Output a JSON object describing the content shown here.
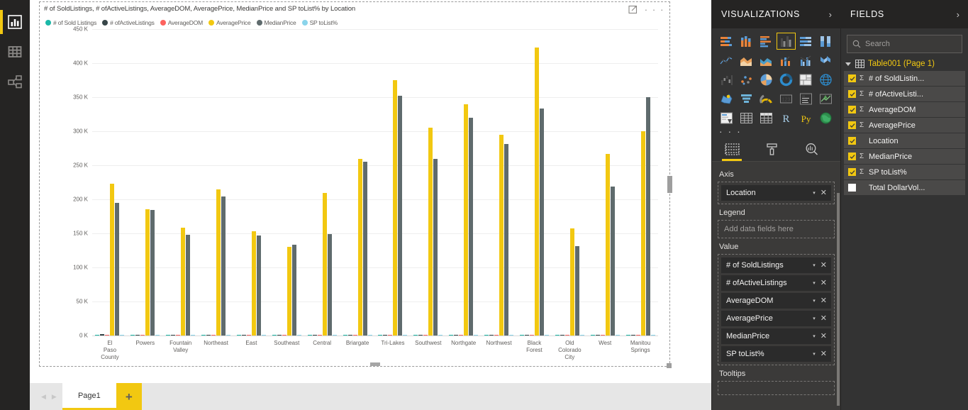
{
  "rail": {
    "items": [
      {
        "name": "report-view",
        "icon": "bar-chart-icon",
        "active": true
      },
      {
        "name": "data-view",
        "icon": "table-icon",
        "active": false
      },
      {
        "name": "model-view",
        "icon": "relationships-icon",
        "active": false
      }
    ]
  },
  "visual": {
    "title": "# of SoldListings, # ofActiveListings, AverageDOM, AveragePrice, MedianPrice and SP toList% by Location",
    "focus_icon": "focus-mode-icon",
    "more_label": "· · ·"
  },
  "pagebar": {
    "prev_arrow": "◀",
    "next_arrow": "▶",
    "tabs": [
      {
        "label": "Page1",
        "active": true
      }
    ],
    "add_label": "+"
  },
  "visualizations": {
    "title": "VISUALIZATIONS",
    "expand_icon": "chevron-right-icon",
    "gallery_more": "· · ·",
    "gallery": [
      {
        "name": "stacked-bar-chart",
        "selected": false
      },
      {
        "name": "stacked-column-chart",
        "selected": false
      },
      {
        "name": "clustered-bar-chart",
        "selected": false
      },
      {
        "name": "clustered-column-chart",
        "selected": true
      },
      {
        "name": "hundred-percent-stacked-bar-chart",
        "selected": false
      },
      {
        "name": "hundred-percent-stacked-column-chart",
        "selected": false
      },
      {
        "name": "line-chart",
        "selected": false
      },
      {
        "name": "area-chart",
        "selected": false
      },
      {
        "name": "stacked-area-chart",
        "selected": false
      },
      {
        "name": "line-and-stacked-column-chart",
        "selected": false
      },
      {
        "name": "line-and-clustered-column-chart",
        "selected": false
      },
      {
        "name": "ribbon-chart",
        "selected": false
      },
      {
        "name": "waterfall-chart",
        "selected": false
      },
      {
        "name": "scatter-chart",
        "selected": false
      },
      {
        "name": "pie-chart",
        "selected": false
      },
      {
        "name": "donut-chart",
        "selected": false
      },
      {
        "name": "treemap",
        "selected": false
      },
      {
        "name": "map",
        "selected": false
      },
      {
        "name": "filled-map",
        "selected": false
      },
      {
        "name": "funnel-chart",
        "selected": false
      },
      {
        "name": "gauge-chart",
        "selected": false
      },
      {
        "name": "card",
        "selected": false
      },
      {
        "name": "multi-row-card",
        "selected": false
      },
      {
        "name": "kpi",
        "selected": false
      },
      {
        "name": "slicer",
        "selected": false
      },
      {
        "name": "table",
        "selected": false
      },
      {
        "name": "matrix",
        "selected": false
      },
      {
        "name": "r-script-visual",
        "selected": false
      },
      {
        "name": "python-visual",
        "selected": false
      },
      {
        "name": "arcgis-map",
        "selected": false
      }
    ],
    "tabs": [
      {
        "name": "fields-tab",
        "icon": "fields-grid-icon",
        "selected": true
      },
      {
        "name": "format-tab",
        "icon": "paint-roller-icon",
        "selected": false
      },
      {
        "name": "analytics-tab",
        "icon": "magnifier-chart-icon",
        "selected": false
      }
    ],
    "wells": [
      {
        "label": "Axis",
        "empty_placeholder": null,
        "chips": [
          {
            "name": "Location"
          }
        ]
      },
      {
        "label": "Legend",
        "empty_placeholder": "Add data fields here",
        "chips": []
      },
      {
        "label": "Value",
        "empty_placeholder": null,
        "chips": [
          {
            "name": "# of SoldListings"
          },
          {
            "name": "# ofActiveListings"
          },
          {
            "name": "AverageDOM"
          },
          {
            "name": "AveragePrice"
          },
          {
            "name": "MedianPrice"
          },
          {
            "name": "SP toList%"
          }
        ]
      },
      {
        "label": "Tooltips",
        "empty_placeholder": null,
        "chips": []
      }
    ],
    "chip_caret": "▾",
    "chip_remove": "✕"
  },
  "fields": {
    "title": "FIELDS",
    "expand_icon": "chevron-right-icon",
    "search": {
      "placeholder": "Search",
      "value": "",
      "icon": "search-icon"
    },
    "table": {
      "name": "Table001 (Page 1)",
      "icon": "table-icon",
      "expanded": true
    },
    "items": [
      {
        "label": "# of SoldListin...",
        "checked": true,
        "measure": true
      },
      {
        "label": "# ofActiveListi...",
        "checked": true,
        "measure": true
      },
      {
        "label": "AverageDOM",
        "checked": true,
        "measure": true
      },
      {
        "label": "AveragePrice",
        "checked": true,
        "measure": true
      },
      {
        "label": "Location",
        "checked": true,
        "measure": false
      },
      {
        "label": "MedianPrice",
        "checked": true,
        "measure": true
      },
      {
        "label": "SP toList%",
        "checked": true,
        "measure": true
      },
      {
        "label": "Total DollarVol...",
        "checked": false,
        "measure": false
      }
    ]
  },
  "colors": {
    "accent": "#f2c811",
    "sold_listings": "#1bb8a8",
    "active_listings": "#374649",
    "average_dom": "#fd625e",
    "average_price": "#f2c811",
    "median_price": "#5f6b6d",
    "sp_to_list": "#8ad4eb",
    "pane_bg": "#333333",
    "rail_bg": "#252423"
  },
  "chart_data": {
    "type": "bar",
    "title": "# of SoldListings, # ofActiveListings, AverageDOM, AveragePrice, MedianPrice and SP toList% by Location",
    "xlabel": "",
    "ylabel": "",
    "ylim": [
      0,
      450000
    ],
    "yticks": [
      "0 K",
      "50 K",
      "100 K",
      "150 K",
      "200 K",
      "250 K",
      "300 K",
      "350 K",
      "400 K",
      "450 K"
    ],
    "ytick_values": [
      0,
      50000,
      100000,
      150000,
      200000,
      250000,
      300000,
      350000,
      400000,
      450000
    ],
    "grid": true,
    "legend_position": "top",
    "categories": [
      "El Paso County",
      "Powers",
      "Fountain Valley",
      "Northeast",
      "East",
      "Southeast",
      "Central",
      "Briargate",
      "Tri-Lakes",
      "Southwest",
      "Northgate",
      "Northwest",
      "Black Forest",
      "Old Colorado City",
      "West",
      "Manitou Springs"
    ],
    "series": [
      {
        "name": "# of Sold Listings",
        "color": "#1bb8a8",
        "values": [
          210,
          95,
          120,
          150,
          105,
          115,
          90,
          130,
          85,
          70,
          75,
          95,
          40,
          35,
          60,
          25
        ]
      },
      {
        "name": "# ofActiveListings",
        "color": "#374649",
        "values": [
          1800,
          420,
          520,
          640,
          430,
          470,
          400,
          560,
          380,
          300,
          330,
          420,
          190,
          160,
          270,
          110
        ]
      },
      {
        "name": "AverageDOM",
        "color": "#fd625e",
        "values": [
          35,
          30,
          32,
          28,
          33,
          31,
          29,
          27,
          38,
          30,
          26,
          28,
          55,
          34,
          31,
          40
        ]
      },
      {
        "name": "AveragePrice",
        "color": "#f2c811",
        "values": [
          223000,
          185000,
          158000,
          215000,
          153000,
          130000,
          209000,
          259000,
          375000,
          305000,
          340000,
          295000,
          423000,
          157000,
          267000,
          300000
        ]
      },
      {
        "name": "MedianPrice",
        "color": "#5f6b6d",
        "values": [
          195000,
          184000,
          148000,
          204000,
          147000,
          133000,
          149000,
          255000,
          352000,
          259000,
          320000,
          281000,
          333000,
          131000,
          219000,
          350000
        ]
      },
      {
        "name": "SP toList%",
        "color": "#8ad4eb",
        "values": [
          99,
          99,
          98,
          99,
          98,
          98,
          98,
          99,
          97,
          98,
          99,
          99,
          96,
          98,
          98,
          97
        ]
      }
    ]
  }
}
